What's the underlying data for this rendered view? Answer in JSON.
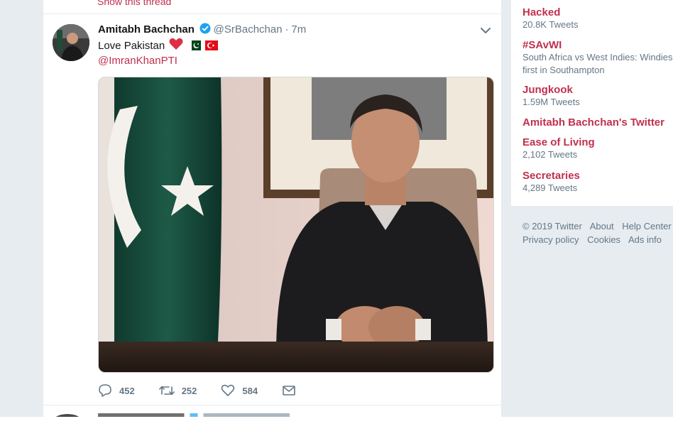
{
  "timeline": {
    "show_thread_label": "Show this thread",
    "tweet": {
      "fullname": "Amitabh Bachchan",
      "username": "@SrBachchan",
      "dot": "·",
      "time": "7m",
      "text": "Love Pakistan",
      "emojis": [
        "red-heart",
        "pakistan-flag",
        "turkey-flag"
      ],
      "mention": "@ImranKhanPTI",
      "actions": {
        "reply_count": "452",
        "retweet_count": "252",
        "like_count": "584"
      }
    }
  },
  "sidebar": {
    "trends": [
      {
        "name": "Hacked",
        "meta": "20.8K Tweets"
      },
      {
        "name": "#SAvWI",
        "desc": "South Africa vs West Indies: Windies first in Southampton"
      },
      {
        "name": "Jungkook",
        "meta": "1.59M Tweets"
      },
      {
        "name": "Amitabh Bachchan's Twitter"
      },
      {
        "name": "Ease of Living",
        "meta": "2,102 Tweets"
      },
      {
        "name": "Secretaries",
        "meta": "4,289 Tweets"
      }
    ],
    "footer": {
      "copyright": "© 2019 Twitter",
      "about": "About",
      "help": "Help Center",
      "privacy": "Privacy policy",
      "cookies": "Cookies",
      "ads": "Ads info"
    }
  },
  "colors": {
    "link": "#c0304e",
    "muted": "#657786",
    "background": "#e6ecf0",
    "verified": "#1da1f2"
  }
}
